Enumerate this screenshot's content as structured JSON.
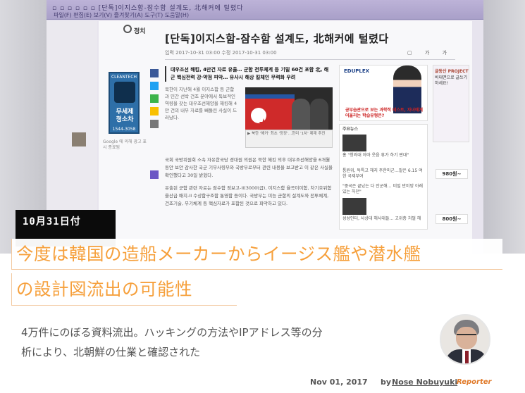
{
  "hero": {
    "browser_tabs": "▫ ▫ ▫ ▫ ▫ ▫   [단독]이지스함-잠수함 설계도, 北해커에 털렸다",
    "browser_menu": "파일(F)  편집(E)  보기(V)  즐겨찾기(A)  도구(T)  도움말(H)",
    "section_label": "정치",
    "headline": "[단독]이지스함-잠수함 설계도, 北해커에 털렸다",
    "byline": "입력 2017-10-31 03:00   수정 2017-10-31 03:00",
    "tools": "▢ 가 가",
    "subhead": "대우조선 해킹, 4만건 자료 유출… 군함 전투체계 등 기밀 60건 포함 北, 해군 핵심전력 강·약점 파악… 유사시 해상 킬체인 무력화 우려",
    "col_text": "북한이 지난해 4월 이지스함 등 군함과 민간 선박 건조 분야에서 독보적인 역량을 갖는 대우조선해양을 해킹해 4만 건의 내부 자료를 빼돌린 사실이 드러났다.",
    "caption": "▶ 북한 '해커' 최초 '등장'…한미 '1차' 제재 추진",
    "body_1": "국회 국방위원회 소속 자유한국당 경대원 의원은 북한 해킹 의후 대우조선해양을 6개월 동안 보안 감사한 국군 기무사령부와 국방부로부터 관련 내용을 보고받고 이 같은 사실을 확인했다고 30일 밝혔다.",
    "body_2": "유출된 군함 관련 자료는 잠수함 정보고-II(3000t급), 이지스함 율곡이이함, 차기호위함 을산급 배치-II 수상함구조함 통영함 등이다. 국방부는 미능 군함의 설계도와 전투체계, 건조기술, 무기체계 등 핵심자료가 포함된 것으로 파악하고 있다.",
    "ad_left": "무세제\n청소차",
    "ad_left_tel": "1544-3058",
    "ad_left_brand": "CLEANTECH",
    "google_note": "Google 에 의해 광고 표시 종료됨",
    "ad_right_brand": "EDUPLEX",
    "ad_right_msg": "공부습관으로 보는 과학적 테스트, 자녀에게 어울리는 학습유형은?",
    "side_header": "주요뉴스",
    "side_items": [
      "홍 \"청와대 아마 웃음 휴가 하기 판대\"",
      "통원위, 독특고 해지 주한미군…말은 6.15 여한 국제부여",
      "\"중국은 끝났는 다 잔군해… 비밀 반미망 아래 있는 하던\"",
      "성성인터, 사상대 해사대들… 고위층 처벌 해"
    ],
    "promo_title": "글동산 PROJECT",
    "promo_body": "비대면으로 글쓰기 하세요!",
    "price_1": "980원~",
    "price_2": "800원~",
    "date_tab": "10月31日付"
  },
  "article": {
    "title_line1": "今度は韓国の造船メーカーからイージス艦や潜水艦",
    "title_line2": "の設計図流出の可能性",
    "summary": "4万件にのぼる資料流出。ハッキングの方法やIPアドレス等の分析により、北朝鮮の仕業と確認された",
    "date": "Nov 01, 2017",
    "by": "by",
    "author": "Nose Nobuyuki",
    "role": "Reporter"
  },
  "colors": {
    "title_orange": "#f6a03c",
    "reporter_orange": "#e07a2a",
    "text_gray": "#555555"
  }
}
